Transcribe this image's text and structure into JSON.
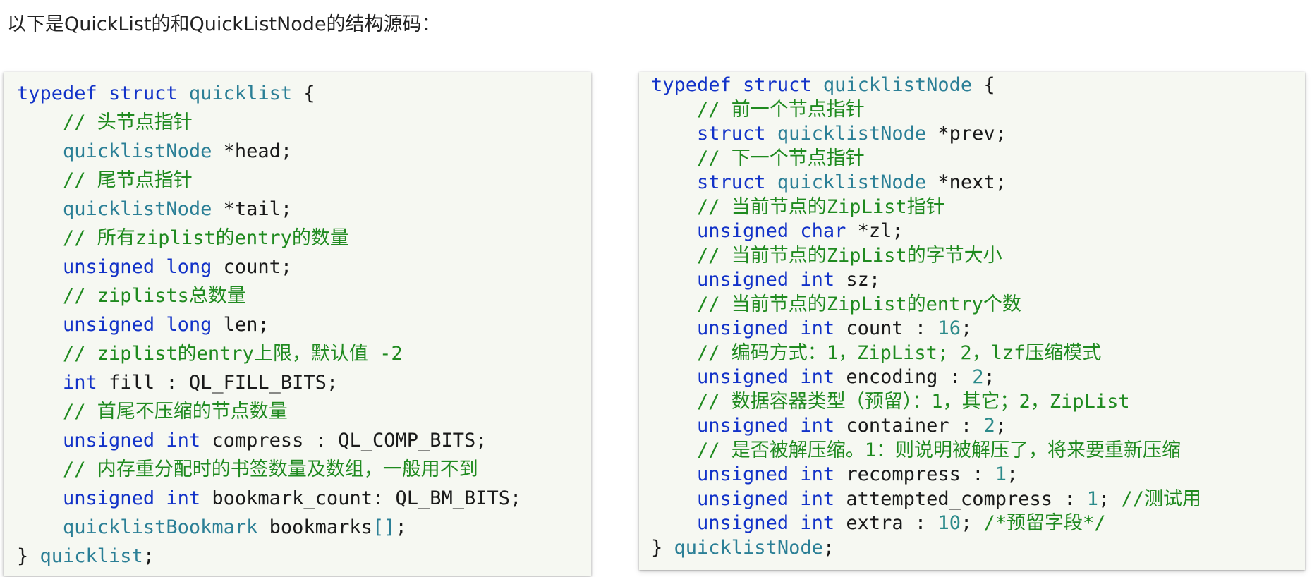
{
  "intro_text": "以下是QuickList的和QuickListNode的结构源码：",
  "colors": {
    "keyword": "#1232c8",
    "type": "#2b7f96",
    "comment": "#1f8a1f",
    "number": "#2b8a8a",
    "plain": "#1a1a1a",
    "block_background": "#f6f8f2"
  },
  "blocks": [
    {
      "name": "quicklist-struct",
      "lines": [
        [
          [
            "kw",
            "typedef "
          ],
          [
            "kw",
            "struct "
          ],
          [
            "type",
            "quicklist"
          ],
          [
            "plain",
            " {"
          ]
        ],
        [
          [
            "plain",
            "    "
          ],
          [
            "comment",
            "// 头节点指针"
          ]
        ],
        [
          [
            "plain",
            "    "
          ],
          [
            "type",
            "quicklistNode"
          ],
          [
            "plain",
            " *head;"
          ]
        ],
        [
          [
            "plain",
            "    "
          ],
          [
            "comment",
            "// 尾节点指针"
          ]
        ],
        [
          [
            "plain",
            "    "
          ],
          [
            "type",
            "quicklistNode"
          ],
          [
            "plain",
            " *tail;"
          ]
        ],
        [
          [
            "plain",
            "    "
          ],
          [
            "comment",
            "// 所有ziplist的entry的数量"
          ]
        ],
        [
          [
            "plain",
            "    "
          ],
          [
            "kw",
            "unsigned "
          ],
          [
            "kw",
            "long"
          ],
          [
            "plain",
            " count;"
          ]
        ],
        [
          [
            "plain",
            "    "
          ],
          [
            "comment",
            "// ziplists总数量"
          ]
        ],
        [
          [
            "plain",
            "    "
          ],
          [
            "kw",
            "unsigned "
          ],
          [
            "kw",
            "long"
          ],
          [
            "plain",
            " len;"
          ]
        ],
        [
          [
            "plain",
            "    "
          ],
          [
            "comment",
            "// ziplist的entry上限，默认值 -2"
          ]
        ],
        [
          [
            "plain",
            "    "
          ],
          [
            "kw",
            "int"
          ],
          [
            "plain",
            " fill : QL_FILL_BITS;"
          ]
        ],
        [
          [
            "plain",
            "    "
          ],
          [
            "comment",
            "// 首尾不压缩的节点数量"
          ]
        ],
        [
          [
            "plain",
            "    "
          ],
          [
            "kw",
            "unsigned "
          ],
          [
            "kw",
            "int"
          ],
          [
            "plain",
            " compress : QL_COMP_BITS;"
          ]
        ],
        [
          [
            "plain",
            "    "
          ],
          [
            "comment",
            "// 内存重分配时的书签数量及数组，一般用不到"
          ]
        ],
        [
          [
            "plain",
            "    "
          ],
          [
            "kw",
            "unsigned "
          ],
          [
            "kw",
            "int"
          ],
          [
            "plain",
            " bookmark_count: QL_BM_BITS;"
          ]
        ],
        [
          [
            "plain",
            "    "
          ],
          [
            "type",
            "quicklistBookmark"
          ],
          [
            "plain",
            " bookmarks"
          ],
          [
            "bracket",
            "[]"
          ],
          [
            "plain",
            ";"
          ]
        ],
        [
          [
            "plain",
            "} "
          ],
          [
            "type",
            "quicklist"
          ],
          [
            "plain",
            ";"
          ]
        ]
      ]
    },
    {
      "name": "quicklistnode-struct",
      "lines": [
        [
          [
            "kw",
            "typedef "
          ],
          [
            "kw",
            "struct "
          ],
          [
            "type",
            "quicklistNode"
          ],
          [
            "plain",
            " {"
          ]
        ],
        [
          [
            "plain",
            "    "
          ],
          [
            "comment",
            "// 前一个节点指针"
          ]
        ],
        [
          [
            "plain",
            "    "
          ],
          [
            "kw",
            "struct "
          ],
          [
            "type",
            "quicklistNode"
          ],
          [
            "plain",
            " *prev;"
          ]
        ],
        [
          [
            "plain",
            "    "
          ],
          [
            "comment",
            "// 下一个节点指针"
          ]
        ],
        [
          [
            "plain",
            "    "
          ],
          [
            "kw",
            "struct "
          ],
          [
            "type",
            "quicklistNode"
          ],
          [
            "plain",
            " *next;"
          ]
        ],
        [
          [
            "plain",
            "    "
          ],
          [
            "comment",
            "// 当前节点的ZipList指针"
          ]
        ],
        [
          [
            "plain",
            "    "
          ],
          [
            "kw",
            "unsigned "
          ],
          [
            "kw",
            "char"
          ],
          [
            "plain",
            " *zl;"
          ]
        ],
        [
          [
            "plain",
            "    "
          ],
          [
            "comment",
            "// 当前节点的ZipList的字节大小"
          ]
        ],
        [
          [
            "plain",
            "    "
          ],
          [
            "kw",
            "unsigned "
          ],
          [
            "kw",
            "int"
          ],
          [
            "plain",
            " sz;"
          ]
        ],
        [
          [
            "plain",
            "    "
          ],
          [
            "comment",
            "// 当前节点的ZipList的entry个数"
          ]
        ],
        [
          [
            "plain",
            "    "
          ],
          [
            "kw",
            "unsigned "
          ],
          [
            "kw",
            "int"
          ],
          [
            "plain",
            " count : "
          ],
          [
            "num",
            "16"
          ],
          [
            "plain",
            ";"
          ]
        ],
        [
          [
            "plain",
            "    "
          ],
          [
            "comment",
            "// 编码方式：1，ZipList; 2，lzf压缩模式"
          ]
        ],
        [
          [
            "plain",
            "    "
          ],
          [
            "kw",
            "unsigned "
          ],
          [
            "kw",
            "int"
          ],
          [
            "plain",
            " encoding : "
          ],
          [
            "num",
            "2"
          ],
          [
            "plain",
            ";"
          ]
        ],
        [
          [
            "plain",
            "    "
          ],
          [
            "comment",
            "// 数据容器类型（预留）：1，其它；2，ZipList"
          ]
        ],
        [
          [
            "plain",
            "    "
          ],
          [
            "kw",
            "unsigned "
          ],
          [
            "kw",
            "int"
          ],
          [
            "plain",
            " container : "
          ],
          [
            "num",
            "2"
          ],
          [
            "plain",
            ";"
          ]
        ],
        [
          [
            "plain",
            "    "
          ],
          [
            "comment",
            "// 是否被解压缩。1：则说明被解压了，将来要重新压缩"
          ]
        ],
        [
          [
            "plain",
            "    "
          ],
          [
            "kw",
            "unsigned "
          ],
          [
            "kw",
            "int"
          ],
          [
            "plain",
            " recompress : "
          ],
          [
            "num",
            "1"
          ],
          [
            "plain",
            ";"
          ]
        ],
        [
          [
            "plain",
            "    "
          ],
          [
            "kw",
            "unsigned "
          ],
          [
            "kw",
            "int"
          ],
          [
            "plain",
            " attempted_compress : "
          ],
          [
            "num",
            "1"
          ],
          [
            "plain",
            "; "
          ],
          [
            "comment",
            "//测试用"
          ]
        ],
        [
          [
            "plain",
            "    "
          ],
          [
            "kw",
            "unsigned "
          ],
          [
            "kw",
            "int"
          ],
          [
            "plain",
            " extra : "
          ],
          [
            "num",
            "10"
          ],
          [
            "plain",
            "; "
          ],
          [
            "comment",
            "/*预留字段*/"
          ]
        ],
        [
          [
            "plain",
            "} "
          ],
          [
            "type",
            "quicklistNode"
          ],
          [
            "plain",
            ";"
          ]
        ]
      ]
    }
  ]
}
